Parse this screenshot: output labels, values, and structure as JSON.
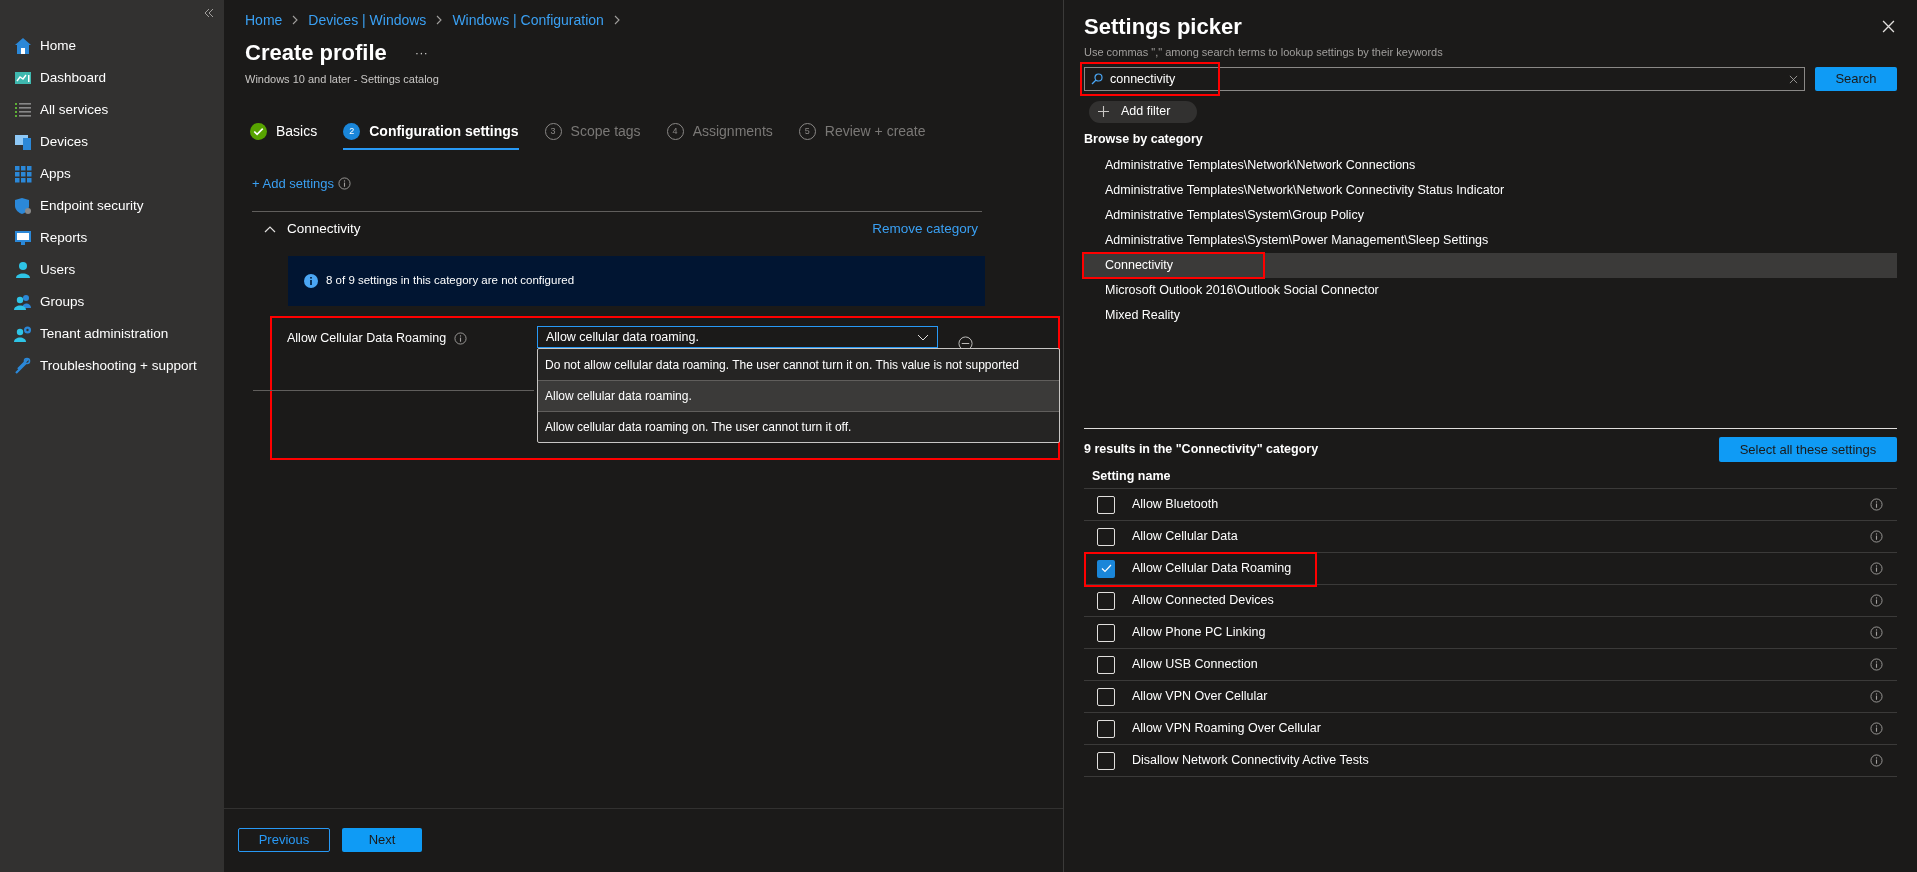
{
  "sidebar": {
    "items": [
      {
        "label": "Home"
      },
      {
        "label": "Dashboard"
      },
      {
        "label": "All services"
      },
      {
        "label": "Devices"
      },
      {
        "label": "Apps"
      },
      {
        "label": "Endpoint security"
      },
      {
        "label": "Reports"
      },
      {
        "label": "Users"
      },
      {
        "label": "Groups"
      },
      {
        "label": "Tenant administration"
      },
      {
        "label": "Troubleshooting + support"
      }
    ]
  },
  "breadcrumb": [
    "Home",
    "Devices | Windows",
    "Windows | Configuration"
  ],
  "page": {
    "title": "Create profile",
    "more": "···",
    "subtitle": "Windows 10 and later - Settings catalog"
  },
  "steps": [
    {
      "label": "Basics",
      "kind": "done",
      "selected": false
    },
    {
      "label": "Configuration settings",
      "number": "2",
      "kind": "numbered",
      "selected": true
    },
    {
      "label": "Scope tags",
      "number": "3",
      "kind": "numbered",
      "selected": false
    },
    {
      "label": "Assignments",
      "number": "4",
      "kind": "numbered",
      "selected": false
    },
    {
      "label": "Review + create",
      "number": "5",
      "kind": "numbered",
      "selected": false
    }
  ],
  "add_settings": "+ Add settings",
  "category": {
    "name": "Connectivity",
    "expanded": true,
    "remove_link": "Remove category",
    "info": "8 of 9 settings in this category are not configured"
  },
  "setting": {
    "label": "Allow Cellular Data Roaming",
    "value": "Allow cellular data roaming.",
    "highlighted": true,
    "options": [
      {
        "label": "Do not allow cellular data roaming. The user cannot turn it on. This value is not supported",
        "selected": false
      },
      {
        "label": "Allow cellular data roaming.",
        "selected": true
      },
      {
        "label": "Allow cellular data roaming on. The user cannot turn it off.",
        "selected": false
      }
    ]
  },
  "footer": {
    "previous": "Previous",
    "next": "Next"
  },
  "picker": {
    "title": "Settings picker",
    "hint": "Use commas \",\" among search terms to lookup settings by their keywords",
    "search": {
      "value": "connectivity",
      "highlighted": true
    },
    "search_button": "Search",
    "add_filter": "Add filter",
    "browse_heading": "Browse by category",
    "categories": [
      {
        "label": "Administrative Templates\\Network\\Network Connections",
        "selected": false,
        "highlighted": false
      },
      {
        "label": "Administrative Templates\\Network\\Network Connectivity Status Indicator",
        "selected": false,
        "highlighted": false
      },
      {
        "label": "Administrative Templates\\System\\Group Policy",
        "selected": false,
        "highlighted": false
      },
      {
        "label": "Administrative Templates\\System\\Power Management\\Sleep Settings",
        "selected": false,
        "highlighted": false
      },
      {
        "label": "Connectivity",
        "selected": true,
        "highlighted": true
      },
      {
        "label": "Microsoft Outlook 2016\\Outlook Social Connector",
        "selected": false,
        "highlighted": false
      },
      {
        "label": "Mixed Reality",
        "selected": false,
        "highlighted": false
      }
    ],
    "results_heading": "9 results in the \"Connectivity\" category",
    "select_all": "Select all these settings",
    "column": "Setting name",
    "rows": [
      {
        "label": "Allow Bluetooth",
        "checked": false,
        "highlighted": false
      },
      {
        "label": "Allow Cellular Data",
        "checked": false,
        "highlighted": false
      },
      {
        "label": "Allow Cellular Data Roaming",
        "checked": true,
        "highlighted": true
      },
      {
        "label": "Allow Connected Devices",
        "checked": false,
        "highlighted": false
      },
      {
        "label": "Allow Phone PC Linking",
        "checked": false,
        "highlighted": false
      },
      {
        "label": "Allow USB Connection",
        "checked": false,
        "highlighted": false
      },
      {
        "label": "Allow VPN Over Cellular",
        "checked": false,
        "highlighted": false
      },
      {
        "label": "Allow VPN Roaming Over Cellular",
        "checked": false,
        "highlighted": false
      },
      {
        "label": "Disallow Network Connectivity Active Tests",
        "checked": false,
        "highlighted": false
      }
    ]
  }
}
